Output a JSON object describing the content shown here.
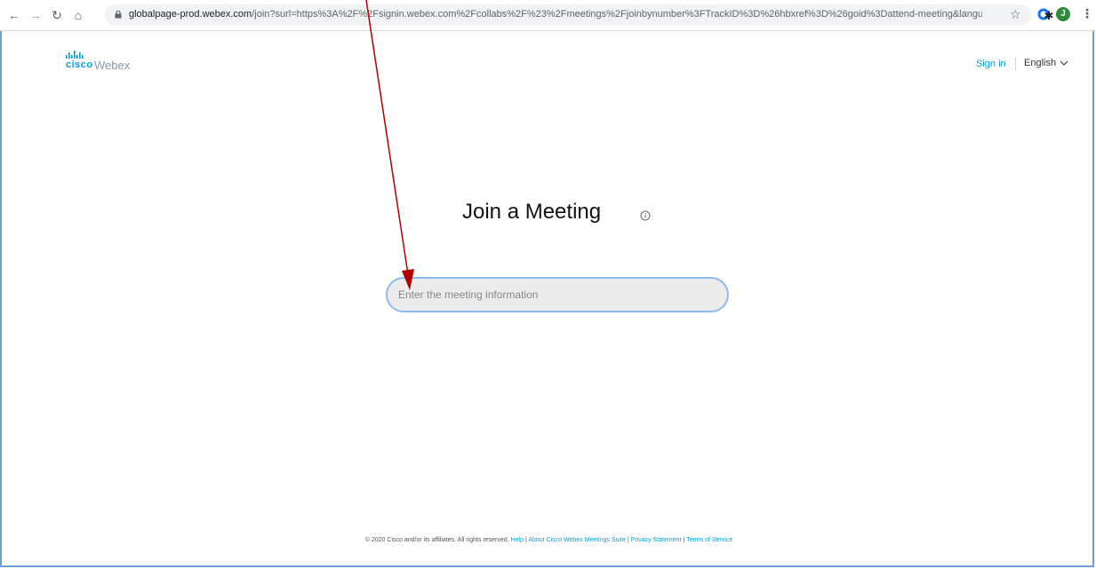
{
  "browser": {
    "url_host": "globalpage-prod.webex.com",
    "url_path": "/join?surl=https%3A%2F%2Fsignin.webex.com%2Fcollabs%2F%23%2Fmeetings%2Fjoinbynumber%3FTrackID%3D%26hbxref%3D%26goid%3Dattend-meeting&language=...",
    "profile_initial": "J"
  },
  "header": {
    "brand_cisco": "cisco",
    "brand_product": "Webex",
    "sign_in_label": "Sign in",
    "language_label": "English"
  },
  "main": {
    "title": "Join a Meeting",
    "input_placeholder": "Enter the meeting information"
  },
  "footer": {
    "copyright": "© 2020 Cisco and/or its affiliates. All rights reserved.",
    "links": [
      "Help",
      "About Cisco Webex Meetings Suite",
      "Privacy Statement",
      "Terms of Service"
    ],
    "separator": "|"
  },
  "colors": {
    "accent": "#049fd9",
    "input_border": "#8cbbf0",
    "annotation_arrow": "#b00000",
    "page_frame": "#6fa0d8"
  }
}
